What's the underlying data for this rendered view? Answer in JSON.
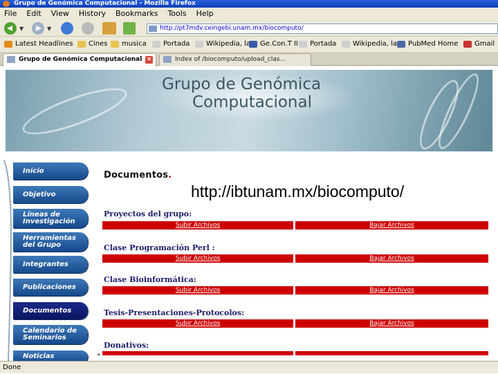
{
  "window": {
    "title": "Grupo de Genómica Computacional - Mozilla Firefox"
  },
  "menu": [
    "File",
    "Edit",
    "View",
    "History",
    "Bookmarks",
    "Tools",
    "Help"
  ],
  "address": {
    "url": "http://pt7mdv.ceingebi.unam.mx/biocomputo/"
  },
  "bookmarks": [
    {
      "label": "Latest Headlines",
      "icon": "rss-icon",
      "color": "#e38b1c"
    },
    {
      "label": "Cines",
      "icon": "folder-icon",
      "color": "#e8c253"
    },
    {
      "label": "musica",
      "icon": "folder-icon",
      "color": "#e8c253"
    },
    {
      "label": "Portada",
      "icon": "wikipedia-icon",
      "color": "#cfcfcf"
    },
    {
      "label": "Wikipedia, la...",
      "icon": "wikipedia-icon",
      "color": "#cfcfcf"
    },
    {
      "label": "Ge.Con.T II",
      "icon": "site-icon",
      "color": "#3a5aa8"
    },
    {
      "label": "Portada",
      "icon": "wikipedia-icon",
      "color": "#cfcfcf"
    },
    {
      "label": "Wikipedia, la...",
      "icon": "wikipedia-icon",
      "color": "#cfcfcf"
    },
    {
      "label": "PubMed Home",
      "icon": "pubmed-icon",
      "color": "#4a6aa8"
    },
    {
      "label": "Gmail",
      "icon": "gmail-icon",
      "color": "#c33"
    }
  ],
  "tabs": [
    {
      "label": "Grupo de Genómica Computacional"
    },
    {
      "label": "Index of /biocomputo/upload_clas..."
    }
  ],
  "banner": {
    "line1": "Grupo de Genómica",
    "line2": "Computacional"
  },
  "sidebar": [
    "Inicio",
    "Objetivo",
    "Líneas de Investigación",
    "Herramientas del Grupo",
    "Integrantes",
    "Publicaciones",
    "Documentos",
    "Calendario de Seminarios",
    "Noticias"
  ],
  "main": {
    "title": "Documentos",
    "overlay_url": "http://ibtunam.mx/biocomputo/",
    "sections": [
      {
        "title": "Proyectos del grupo:",
        "upload": "Subir Archivos",
        "download": "Bajar Archivos"
      },
      {
        "title": "Clase Programación Perl :",
        "upload": "Subir Archivos",
        "download": "Bajar Archivos"
      },
      {
        "title": "Clase Bioinformática:",
        "upload": "Subir Archivos",
        "download": "Bajar Archivos"
      },
      {
        "title": "Tesis-Presentaciones-Protocolos:",
        "upload": "Subir Archivos",
        "download": "Bajar Archivos"
      },
      {
        "title": "Donativos:"
      }
    ]
  },
  "status": {
    "text": "Done"
  }
}
